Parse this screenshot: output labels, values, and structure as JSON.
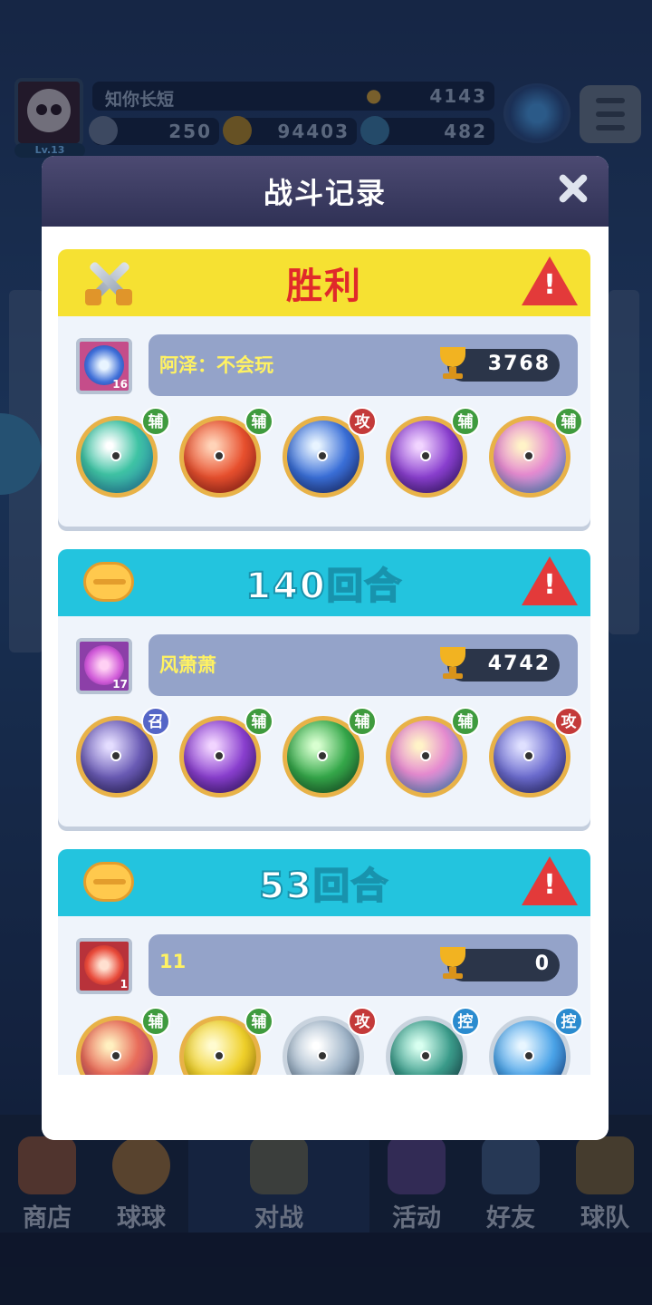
{
  "background": {
    "player_name": "知你长短",
    "trophies": "4143",
    "level": "Lv.13",
    "resources": [
      "250",
      "94403",
      "482"
    ]
  },
  "bottom_nav": [
    {
      "label": "商店",
      "icon": "shop-icon"
    },
    {
      "label": "球球",
      "icon": "ball-icon"
    },
    {
      "label": "对战",
      "icon": "battle-icon"
    },
    {
      "label": "活动",
      "icon": "event-icon"
    },
    {
      "label": "好友",
      "icon": "friends-icon"
    },
    {
      "label": "球队",
      "icon": "team-icon"
    }
  ],
  "modal": {
    "title": "战斗记录"
  },
  "records": [
    {
      "result": "胜利",
      "type": "win",
      "player": "阿泽：不会玩",
      "avatar_level": "16",
      "trophies": "3768",
      "balls": [
        {
          "tag": "辅",
          "kind": "assist",
          "color": "#3fc3a4"
        },
        {
          "tag": "辅",
          "kind": "assist",
          "color": "#e8502e"
        },
        {
          "tag": "攻",
          "kind": "attack",
          "color": "#3a6fd8"
        },
        {
          "tag": "辅",
          "kind": "assist",
          "color": "#8a3fcf"
        },
        {
          "tag": "辅",
          "kind": "assist",
          "color": "#e58bd0"
        }
      ]
    },
    {
      "result": "140回合",
      "type": "draw",
      "player": "风萧萧",
      "avatar_level": "17",
      "trophies": "4742",
      "balls": [
        {
          "tag": "召",
          "kind": "summon",
          "color": "#6a5bb5"
        },
        {
          "tag": "辅",
          "kind": "assist",
          "color": "#8a3fcf"
        },
        {
          "tag": "辅",
          "kind": "assist",
          "color": "#35a84a"
        },
        {
          "tag": "辅",
          "kind": "assist",
          "color": "#e58bd0"
        },
        {
          "tag": "攻",
          "kind": "attack",
          "color": "#6c6ccf"
        }
      ]
    },
    {
      "result": "53回合",
      "type": "draw",
      "player": "11",
      "avatar_level": "1",
      "trophies": "0",
      "balls": [
        {
          "tag": "辅",
          "kind": "assist",
          "color": "#e86c5a"
        },
        {
          "tag": "辅",
          "kind": "assist",
          "color": "#efd02a"
        },
        {
          "tag": "攻",
          "kind": "attack",
          "color": "#9fb4c8"
        },
        {
          "tag": "控",
          "kind": "control",
          "color": "#3a9b8a"
        },
        {
          "tag": "控",
          "kind": "control",
          "color": "#4aa3e8"
        }
      ]
    }
  ]
}
